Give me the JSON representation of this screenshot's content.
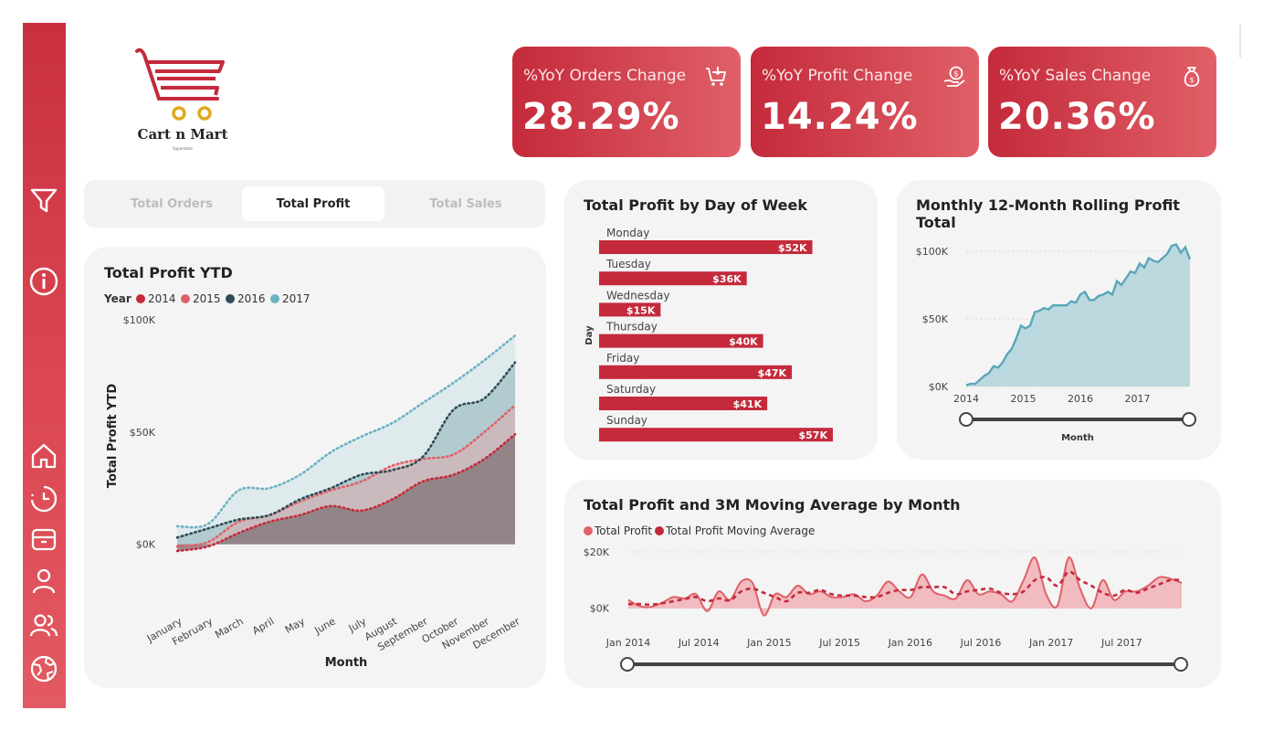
{
  "brand": {
    "name": "Cart n Mart",
    "tagline": "Superstore"
  },
  "sidebar": {
    "icons": [
      "filter-icon",
      "info-icon",
      "home-icon",
      "clock-icon",
      "package-icon",
      "user-icon",
      "users-icon",
      "globe-icon"
    ]
  },
  "kpis": [
    {
      "title": "%YoY Orders Change",
      "value": "28.29%",
      "icon": "cart-icon"
    },
    {
      "title": "%YoY Profit Change",
      "value": "14.24%",
      "icon": "coin-hand-icon"
    },
    {
      "title": "%YoY Sales Change",
      "value": "20.36%",
      "icon": "money-bag-icon"
    }
  ],
  "tabs": [
    {
      "label": "Total Orders",
      "active": false
    },
    {
      "label": "Total Profit",
      "active": true
    },
    {
      "label": "Total Sales",
      "active": false
    }
  ],
  "colors": {
    "accent": "#c42a3b",
    "y2014": "#c42a3b",
    "y2015": "#e06068",
    "y2016": "#2f4b55",
    "y2017": "#6bb3c3"
  },
  "chart_data": [
    {
      "type": "area",
      "title": "Total Profit YTD",
      "legend_title": "Year",
      "xlabel": "Month",
      "ylabel": "Total Profit YTD",
      "ytick_labels": [
        "$100K",
        "$50K",
        "$0K"
      ],
      "ylim": [
        -3000,
        100000
      ],
      "categories": [
        "January",
        "February",
        "March",
        "April",
        "May",
        "June",
        "July",
        "August",
        "September",
        "October",
        "November",
        "December"
      ],
      "series": [
        {
          "name": "2014",
          "values": [
            -3000,
            -1000,
            5000,
            10000,
            13000,
            17000,
            15000,
            20000,
            28000,
            31000,
            38000,
            49000
          ]
        },
        {
          "name": "2015",
          "values": [
            -1000,
            1000,
            10000,
            13000,
            19000,
            24000,
            28000,
            35000,
            38000,
            40000,
            50000,
            62000
          ]
        },
        {
          "name": "2016",
          "values": [
            3000,
            7000,
            11000,
            13000,
            20000,
            25000,
            31000,
            33000,
            39000,
            60000,
            65000,
            81000
          ]
        },
        {
          "name": "2017",
          "values": [
            8000,
            9000,
            24000,
            25000,
            31000,
            41000,
            48000,
            54000,
            63000,
            72000,
            82000,
            93000
          ]
        }
      ],
      "legend": "top-left",
      "grid": false
    },
    {
      "type": "bar",
      "title": "Total Profit by Day of Week",
      "ylabel": "Day",
      "categories": [
        "Monday",
        "Tuesday",
        "Wednesday",
        "Thursday",
        "Friday",
        "Saturday",
        "Sunday"
      ],
      "values": [
        52,
        36,
        15,
        40,
        47,
        41,
        57
      ],
      "labels": [
        "$52K",
        "$36K",
        "$15K",
        "$40K",
        "$47K",
        "$41K",
        "$57K"
      ],
      "orientation": "horizontal"
    },
    {
      "type": "area",
      "title": "Monthly 12-Month Rolling Profit Total",
      "xlabel": "Month",
      "xtick_labels": [
        "2014",
        "2015",
        "2016",
        "2017"
      ],
      "ytick_labels": [
        "$100K",
        "$50K",
        "$0K"
      ],
      "ylim": [
        0,
        100000
      ],
      "values": [
        1000,
        2000,
        2000,
        5000,
        8000,
        10000,
        15000,
        14000,
        18000,
        24000,
        28000,
        36000,
        45000,
        43000,
        45000,
        55000,
        56000,
        58000,
        57000,
        60000,
        60000,
        60000,
        60000,
        63000,
        62000,
        68000,
        70000,
        64000,
        64000,
        67000,
        68000,
        70000,
        68000,
        78000,
        75000,
        80000,
        85000,
        84000,
        91000,
        88000,
        95000,
        93000,
        92000,
        95000,
        98000,
        104000,
        105000,
        99000,
        103000,
        94000
      ],
      "grid": true
    },
    {
      "type": "area",
      "title": "Total Profit and 3M Moving Average by Month",
      "xtick_labels": [
        "Jan 2014",
        "Jul 2014",
        "Jan 2015",
        "Jul 2015",
        "Jan 2016",
        "Jul 2016",
        "Jan 2017",
        "Jul 2017"
      ],
      "ytick_labels": [
        "$20K",
        "$0K"
      ],
      "ylim": [
        -3000,
        20000
      ],
      "series": [
        {
          "name": "Total Profit",
          "values": [
            3000,
            800,
            500,
            2000,
            4000,
            3500,
            5000,
            -1000,
            6000,
            3000,
            9500,
            9000,
            -2500,
            5000,
            4000,
            8000,
            5000,
            6000,
            4000,
            4000,
            5000,
            2500,
            4500,
            9500,
            6000,
            4000,
            12000,
            6000,
            4500,
            3500,
            10000,
            5000,
            6000,
            5000,
            2500,
            10000,
            18000,
            5000,
            1000,
            18000,
            7000,
            0,
            10000,
            3000,
            6000,
            6000,
            8000,
            11000,
            10500,
            9000
          ]
        },
        {
          "name": "Total Profit Moving Average",
          "values": [
            1500,
            1500,
            1300,
            1800,
            2500,
            3300,
            4000,
            2500,
            3500,
            2800,
            6000,
            7000,
            5500,
            4000,
            2500,
            5500,
            5500,
            6500,
            5000,
            4500,
            4500,
            4000,
            4000,
            5500,
            6500,
            6500,
            7500,
            7500,
            7500,
            5000,
            6000,
            6500,
            7000,
            5500,
            5000,
            6000,
            10000,
            11000,
            8000,
            13000,
            10000,
            8000,
            5500,
            4500,
            6500,
            5500,
            7000,
            8500,
            10000,
            10000
          ]
        }
      ],
      "legend": "top-left",
      "grid": true
    }
  ]
}
